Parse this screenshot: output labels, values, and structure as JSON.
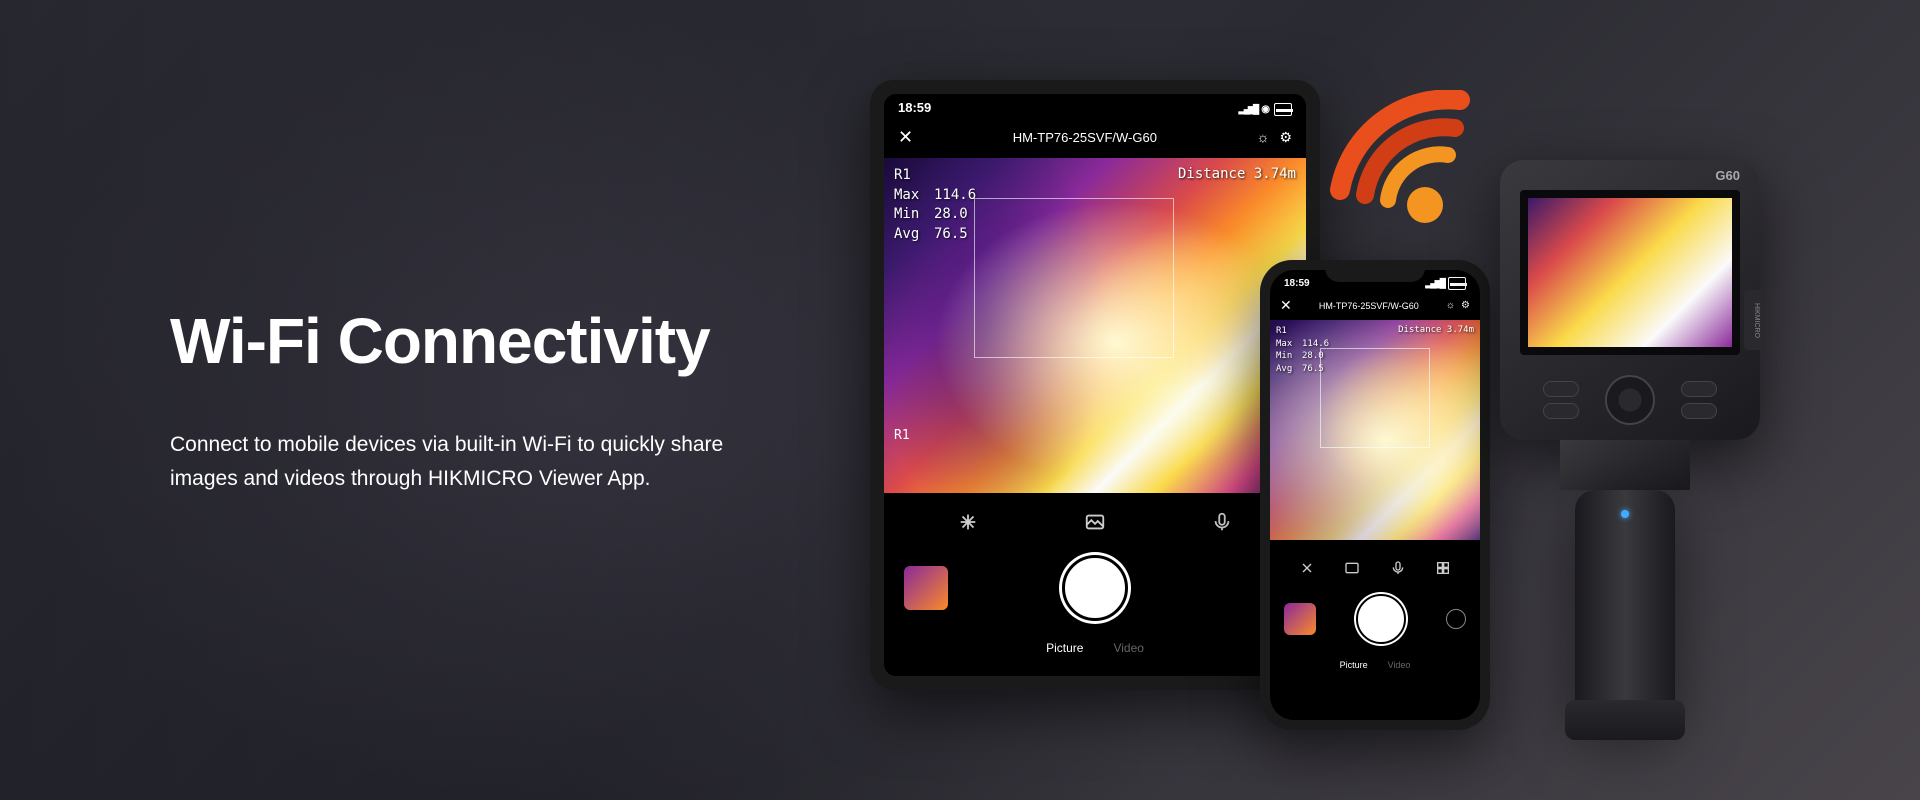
{
  "hero": {
    "title": "Wi-Fi Connectivity",
    "description": "Connect to mobile devices via built-in Wi-Fi to quickly share images and videos through HIKMICRO Viewer App."
  },
  "app": {
    "time": "18:59",
    "device_name": "HM-TP76-25SVF/W-G60",
    "thermal": {
      "region": "R1",
      "max_label": "Max",
      "max_value": "114.6",
      "min_label": "Min",
      "min_value": "28.0",
      "avg_label": "Avg",
      "avg_value": "76.5",
      "distance_label": "Distance",
      "distance_value": "3.74m",
      "marker": "R1"
    },
    "modes": {
      "picture": "Picture",
      "video": "Video"
    }
  },
  "camera": {
    "model": "G60",
    "brand": "HIKMICRO"
  },
  "colors": {
    "wifi_primary": "#e94f1d",
    "wifi_secondary": "#f39520",
    "accent": "#ffffff"
  }
}
